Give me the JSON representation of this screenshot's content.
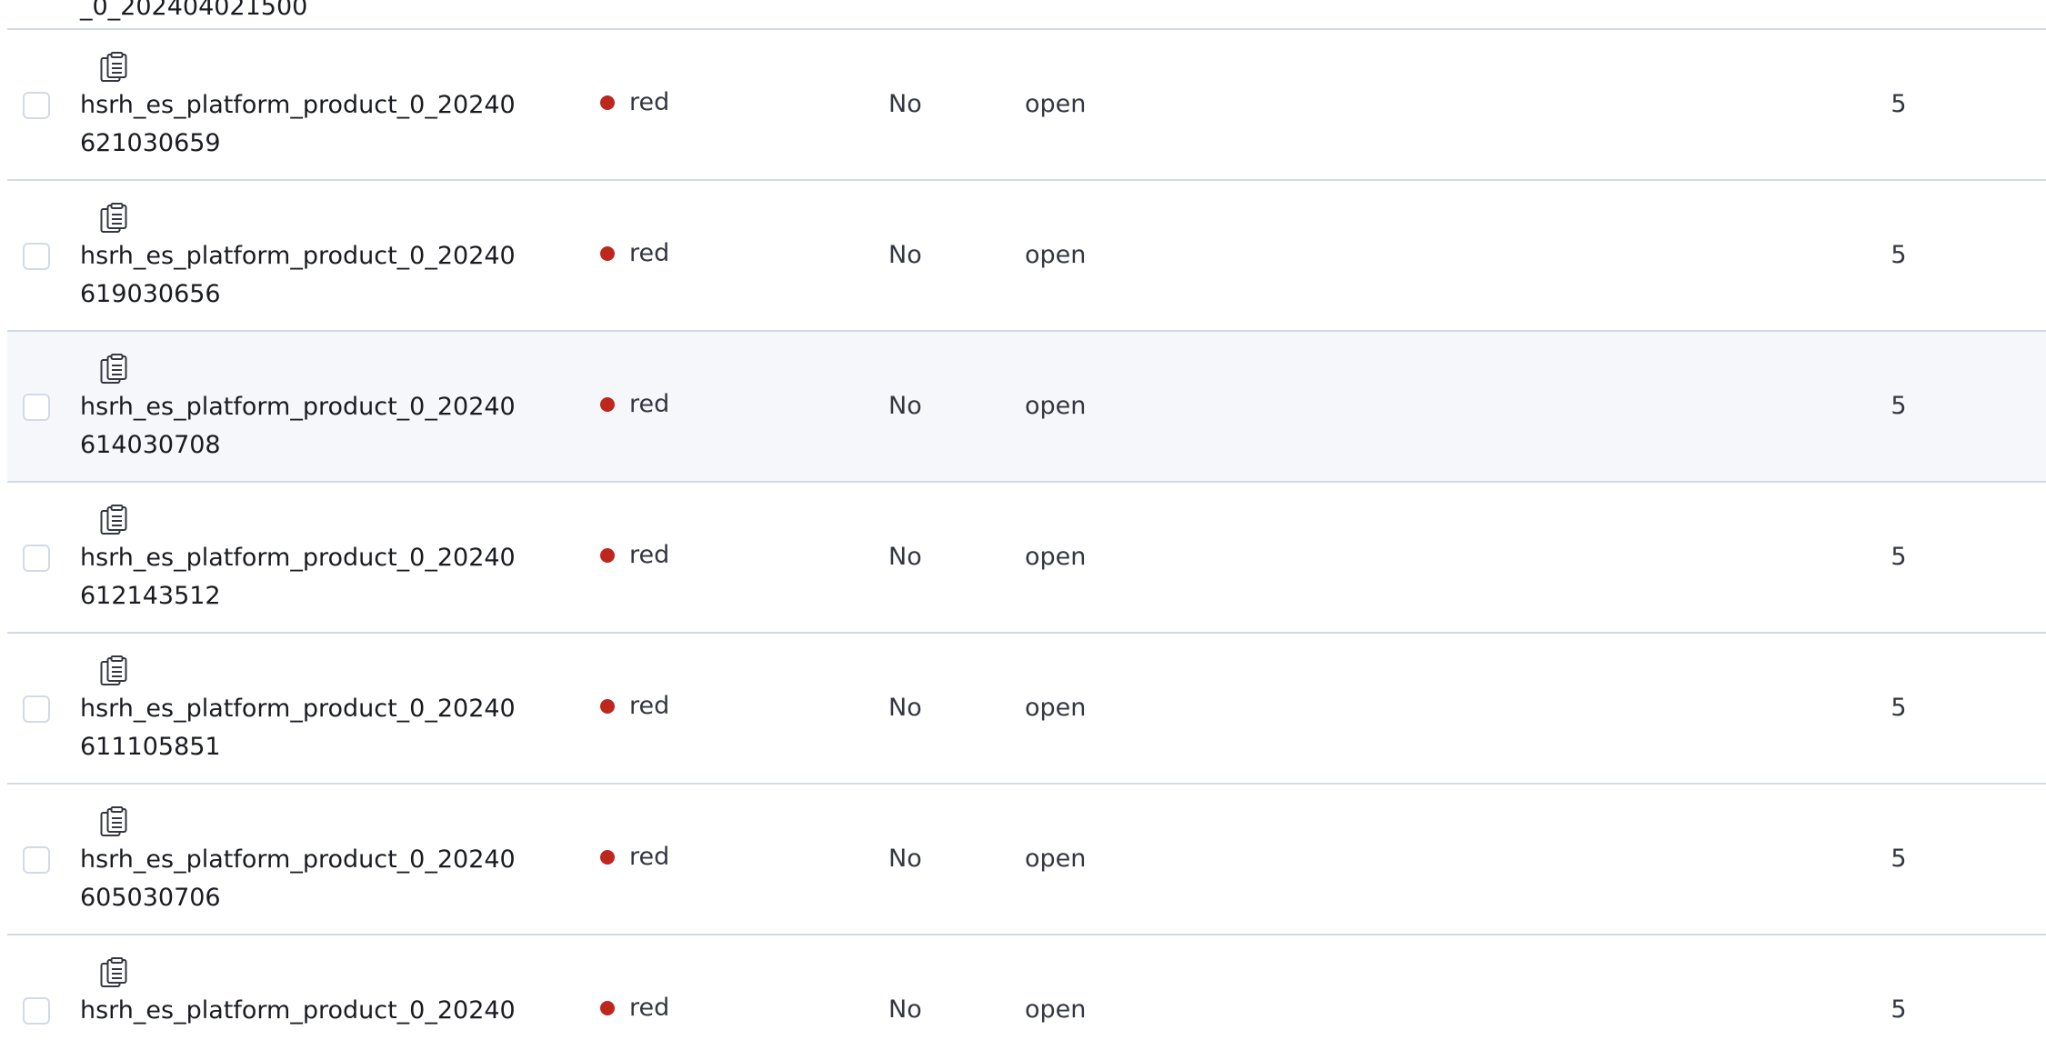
{
  "table": {
    "health_color": "#bd271e",
    "partial_top_row": {
      "name_line2": "_0_202404021500"
    },
    "rows": [
      {
        "name_line1": "hsrh_es_platform_product_0_20240",
        "name_line2": "621030659",
        "health": "red",
        "frozen": "No",
        "status": "open",
        "shards": "5"
      },
      {
        "name_line1": "hsrh_es_platform_product_0_20240",
        "name_line2": "619030656",
        "health": "red",
        "frozen": "No",
        "status": "open",
        "shards": "5"
      },
      {
        "name_line1": "hsrh_es_platform_product_0_20240",
        "name_line2": "614030708",
        "health": "red",
        "frozen": "No",
        "status": "open",
        "shards": "5"
      },
      {
        "name_line1": "hsrh_es_platform_product_0_20240",
        "name_line2": "612143512",
        "health": "red",
        "frozen": "No",
        "status": "open",
        "shards": "5"
      },
      {
        "name_line1": "hsrh_es_platform_product_0_20240",
        "name_line2": "611105851",
        "health": "red",
        "frozen": "No",
        "status": "open",
        "shards": "5"
      },
      {
        "name_line1": "hsrh_es_platform_product_0_20240",
        "name_line2": "605030706",
        "health": "red",
        "frozen": "No",
        "status": "open",
        "shards": "5"
      },
      {
        "name_line1": "hsrh_es_platform_product_0_20240",
        "name_line2": "",
        "health": "red",
        "frozen": "No",
        "status": "open",
        "shards": "5"
      }
    ],
    "icons": {
      "copy": "clipboard-copy-icon",
      "health": "status-dot-icon"
    }
  }
}
